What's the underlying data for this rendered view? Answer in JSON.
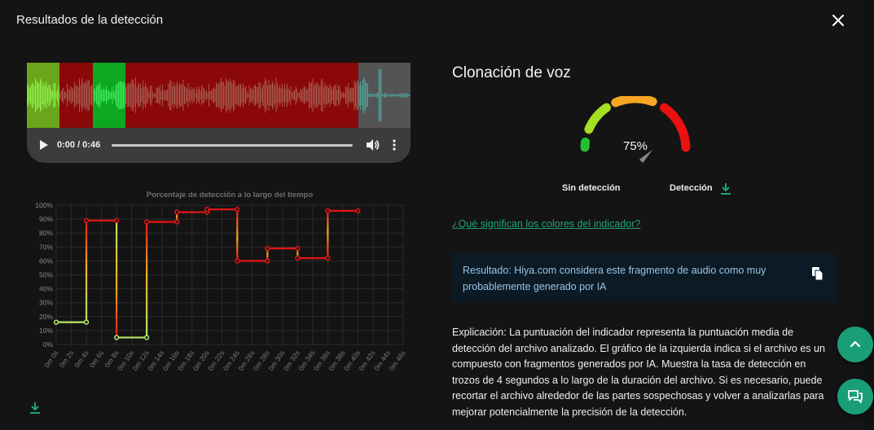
{
  "modal": {
    "title": "Resultados de la detección"
  },
  "waveform": {
    "segments": [
      {
        "from": 0,
        "to": 8.5,
        "color": "#6aa61c",
        "wave": "#8ff04a"
      },
      {
        "from": 8.5,
        "to": 17.3,
        "color": "#8a0808",
        "wave": "#a45a4e"
      },
      {
        "from": 17.3,
        "to": 25.7,
        "color": "#0ea81e",
        "wave": "#3ee85a"
      },
      {
        "from": 25.7,
        "to": 86.4,
        "color": "#8a0808",
        "wave": "#a45a4e"
      },
      {
        "from": 86.4,
        "to": 100,
        "color": "#545454",
        "wave": "#4fa39a"
      }
    ]
  },
  "player": {
    "time": "0:00 / 0:46"
  },
  "chart_data": {
    "type": "line",
    "title": "Porcentaje de detección a lo largo del tiempo",
    "x_ticks": [
      "0m 0s",
      "0m 2s",
      "0m 4s",
      "0m 6s",
      "0m 8s",
      "0m 10s",
      "0m 12s",
      "0m 14s",
      "0m 16s",
      "0m 18s",
      "0m 20s",
      "0m 22s",
      "0m 24s",
      "0m 26s",
      "0m 28s",
      "0m 30s",
      "0m 32s",
      "0m 34s",
      "0m 36s",
      "0m 38s",
      "0m 40s",
      "0m 42s",
      "0m 44s",
      "0m 46s"
    ],
    "y_ticks": [
      "0%",
      "10%",
      "20%",
      "30%",
      "40%",
      "50%",
      "60%",
      "70%",
      "80%",
      "90%",
      "100%"
    ],
    "ylim": [
      0,
      100
    ],
    "xlim": [
      0,
      46
    ],
    "grid": true,
    "points": [
      {
        "x": 0,
        "y": 16
      },
      {
        "x": 4,
        "y": 16
      },
      {
        "x": 4,
        "y": 89
      },
      {
        "x": 8,
        "y": 89
      },
      {
        "x": 8,
        "y": 5
      },
      {
        "x": 12,
        "y": 5
      },
      {
        "x": 12,
        "y": 88
      },
      {
        "x": 16,
        "y": 88
      },
      {
        "x": 16,
        "y": 95
      },
      {
        "x": 20,
        "y": 95
      },
      {
        "x": 20,
        "y": 97
      },
      {
        "x": 24,
        "y": 97
      },
      {
        "x": 24,
        "y": 60
      },
      {
        "x": 28,
        "y": 60
      },
      {
        "x": 28,
        "y": 69
      },
      {
        "x": 32,
        "y": 69
      },
      {
        "x": 32,
        "y": 62
      },
      {
        "x": 36,
        "y": 62
      },
      {
        "x": 36,
        "y": 96
      },
      {
        "x": 40,
        "y": 96
      }
    ]
  },
  "voice": {
    "title": "Clonación de voz",
    "score": "75%",
    "score_value": 75,
    "label_none": "Sin detección",
    "label_detect": "Detección",
    "colors": {
      "green": "#22c22e",
      "lime": "#a6e023",
      "orange": "#f5a623",
      "red": "#ea1111"
    }
  },
  "colors_link": "¿Qué significan los colores del indicador?",
  "result": {
    "text": "Resultado: Hiya.com considera este fragmento de audio como muy probablemente generado por IA"
  },
  "explanation": {
    "text": "Explicación: La puntuación del indicador representa la puntuación media de detección del archivo analizado. El gráfico de la izquierda indica si el archivo es un compuesto con fragmentos generados por IA. Muestra la tasa de detección en trozos de 4 segundos a lo largo de la duración del archivo. Si es necesario, puede recortar el archivo alrededor de las partes sospechosas y volver a analizarlas para mejorar potencialmente la precisión de la detección."
  },
  "accent_color": "#1a9e78"
}
